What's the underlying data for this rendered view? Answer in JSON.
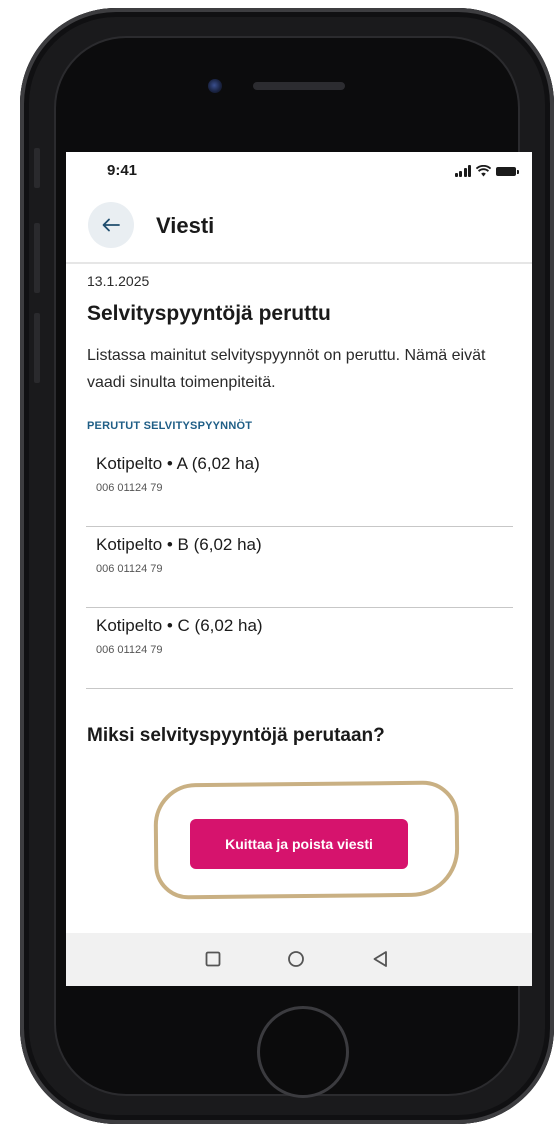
{
  "status_bar": {
    "time": "9:41",
    "icons": [
      "signal-icon",
      "wifi-icon",
      "battery-icon"
    ]
  },
  "app_bar": {
    "back_icon": "arrow-left-icon",
    "title": "Viesti"
  },
  "message": {
    "date": "13.1.2025",
    "heading": "Selvityspyyntöjä peruttu",
    "body": "Listassa mainitut selvityspyynnöt on peruttu. Nämä eivät vaadi sinulta toimenpiteitä.",
    "section_label": "PERUTUT SELVITYSPYYNNÖT",
    "items": [
      {
        "title": "Kotipelto • A (6,02 ha)",
        "subtitle": "006 01124 79"
      },
      {
        "title": "Kotipelto • B (6,02 ha)",
        "subtitle": "006 01124 79"
      },
      {
        "title": "Kotipelto • C (6,02 ha)",
        "subtitle": "006 01124 79"
      }
    ],
    "question": "Miksi selvityspyyntöjä perutaan?"
  },
  "action": {
    "button_label": "Kuittaa ja poista viesti"
  },
  "system_nav": {
    "icons": [
      "recent-apps-icon",
      "home-circle-icon",
      "back-triangle-icon"
    ]
  },
  "colors": {
    "primary_button": "#d6136d",
    "section_label": "#1f5e86",
    "highlight_ring": "#c9b083",
    "back_button_bg": "#e9eef2",
    "nav_bar_bg": "#f1f1f1"
  }
}
